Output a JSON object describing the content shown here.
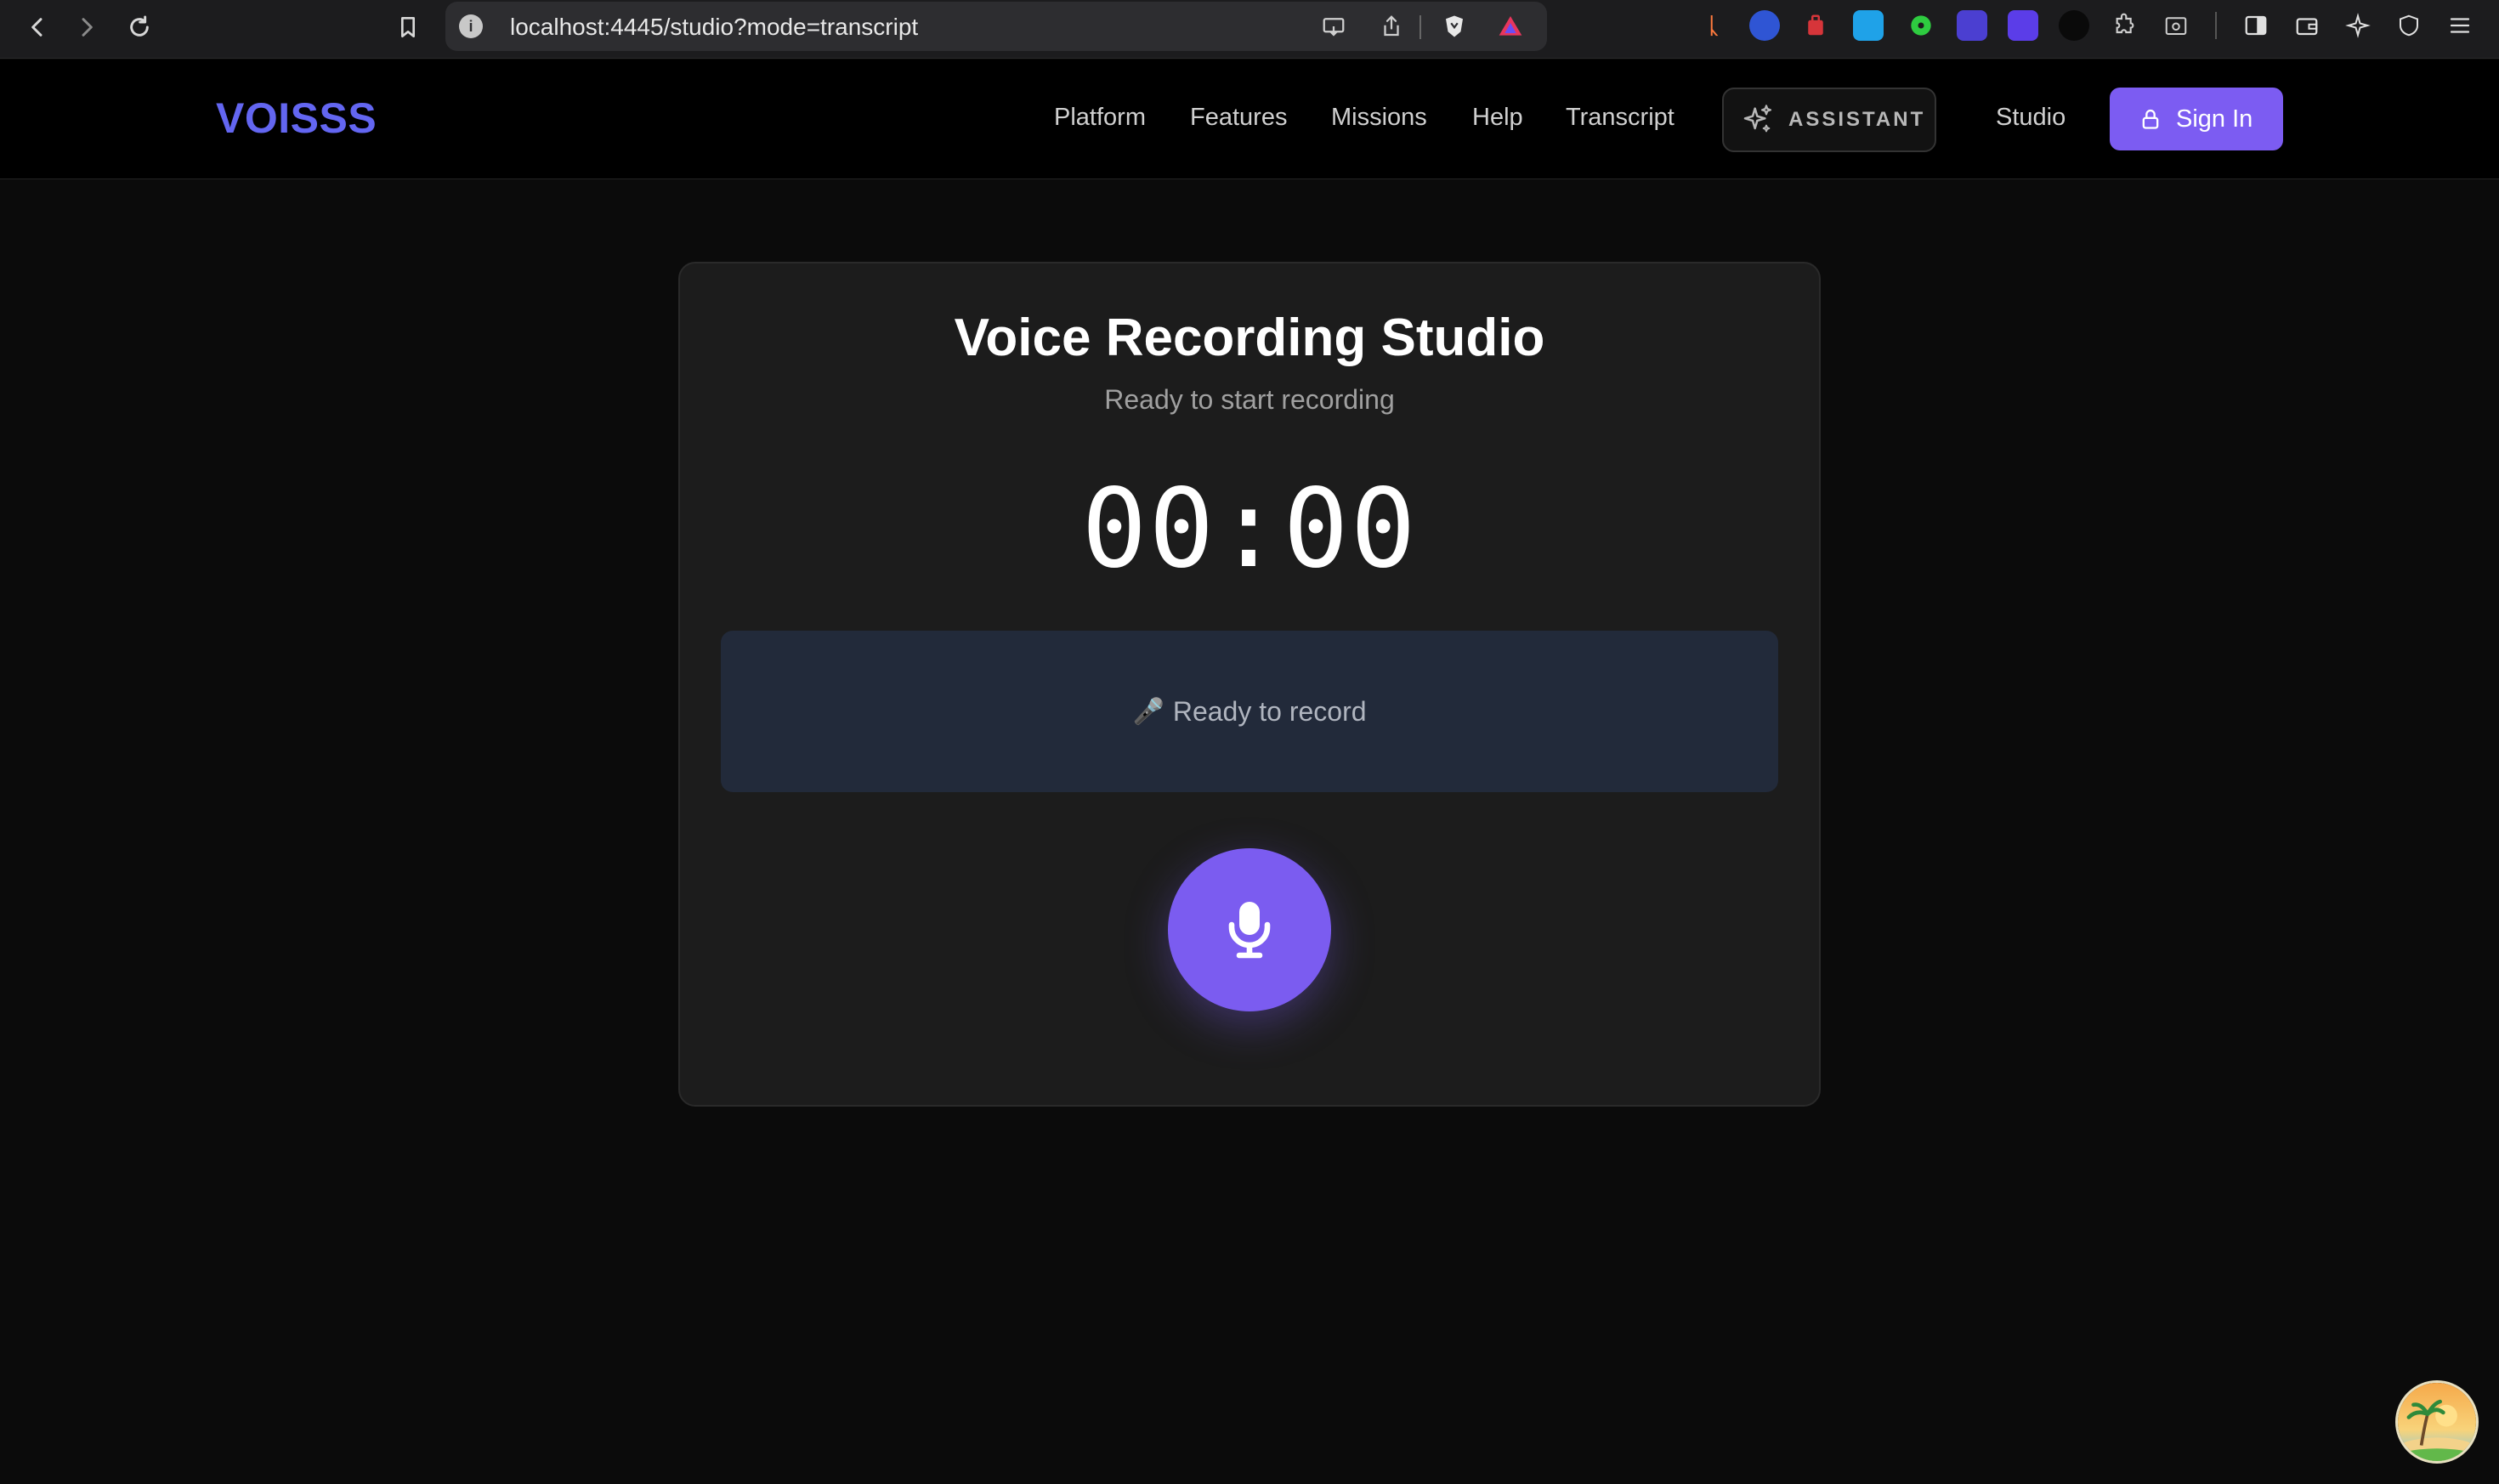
{
  "browser": {
    "url": "localhost:4445/studio?mode=transcript",
    "info_glyph": "i"
  },
  "header": {
    "logo": "VOISSS",
    "nav": [
      {
        "label": "Platform"
      },
      {
        "label": "Features"
      },
      {
        "label": "Missions"
      },
      {
        "label": "Help"
      },
      {
        "label": "Transcript"
      }
    ],
    "assistant_label": "ASSISTANT",
    "studio_label": "Studio",
    "signin_label": "Sign In"
  },
  "studio": {
    "title": "Voice Recording Studio",
    "status": "Ready to start recording",
    "timer": "00:00",
    "transcript_placeholder": "Ready to record",
    "transcript_icon": "🎤"
  },
  "colors": {
    "accent": "#7c5cf2",
    "logo": "#6366f1",
    "card_bg": "#1c1c1c",
    "transcript_bg": "#222a3a",
    "page_bg": "#0b0b0b"
  },
  "icons": {
    "back": "back-arrow-icon",
    "forward": "forward-arrow-icon",
    "reload": "reload-icon",
    "bookmark": "bookmark-icon",
    "info": "site-info-icon",
    "assistant": "sparkle-icon",
    "signin": "lock-icon",
    "record": "microphone-icon"
  }
}
